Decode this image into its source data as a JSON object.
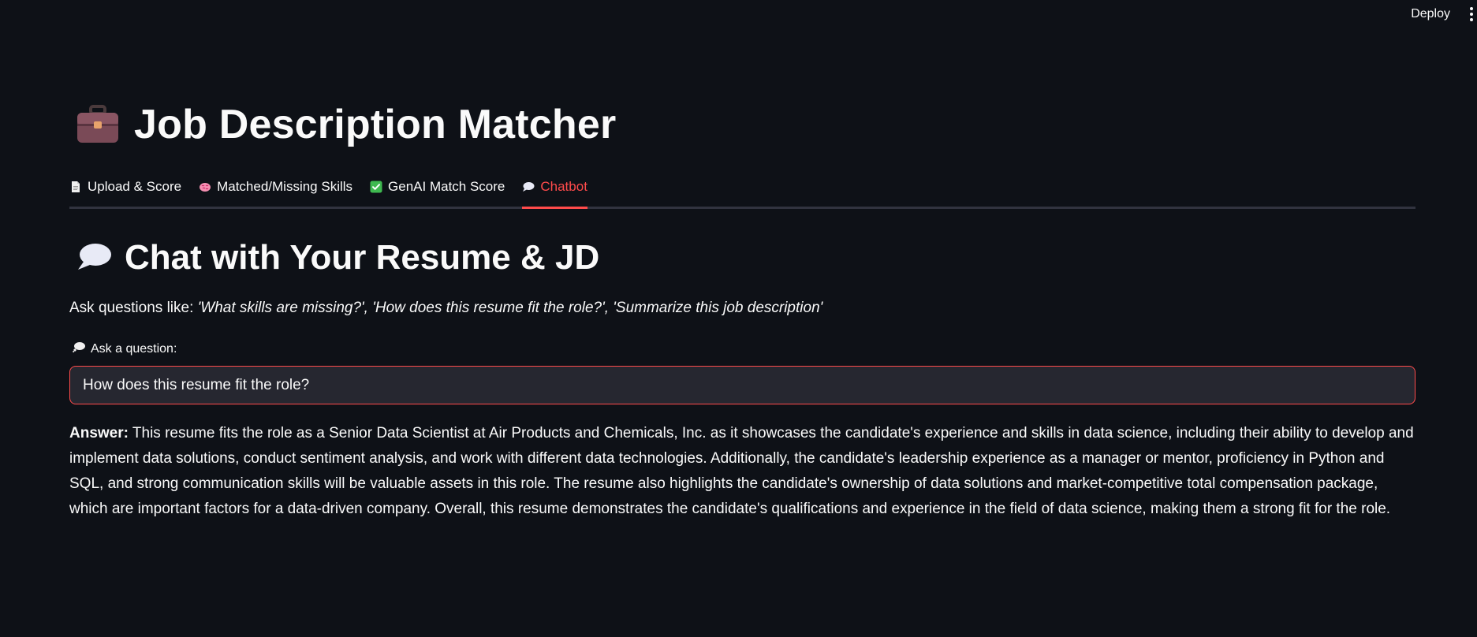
{
  "topbar": {
    "deploy_label": "Deploy",
    "menu_icon": "kebab-menu-icon"
  },
  "header": {
    "icon": "briefcase-icon",
    "title": "Job Description Matcher"
  },
  "tabs": [
    {
      "label": "Upload & Score",
      "icon": "page-icon",
      "active": false
    },
    {
      "label": "Matched/Missing Skills",
      "icon": "brain-icon",
      "active": false
    },
    {
      "label": "GenAI Match Score",
      "icon": "check-mark-icon",
      "active": false
    },
    {
      "label": "Chatbot",
      "icon": "speech-balloon-icon",
      "active": true
    }
  ],
  "section": {
    "icon": "speech-balloon-icon",
    "title": "Chat with Your Resume & JD"
  },
  "hint": {
    "prefix": "Ask questions like: ",
    "examples": "'What skills are missing?', 'How does this resume fit the role?', 'Summarize this job description'"
  },
  "question": {
    "label_icon": "thought-balloon-icon",
    "label": "Ask a question:",
    "value": "How does this resume fit the role?"
  },
  "answer": {
    "label": "Answer:",
    "text": " This resume fits the role as a Senior Data Scientist at Air Products and Chemicals, Inc. as it showcases the candidate's experience and skills in data science, including their ability to develop and implement data solutions, conduct sentiment analysis, and work with different data technologies. Additionally, the candidate's leadership experience as a manager or mentor, proficiency in Python and SQL, and strong communication skills will be valuable assets in this role. The resume also highlights the candidate's ownership of data solutions and market-competitive total compensation package, which are important factors for a data-driven company. Overall, this resume demonstrates the candidate's qualifications and experience in the field of data science, making them a strong fit for the role."
  },
  "colors": {
    "background": "#0e1117",
    "accent": "#ff4b4b",
    "input_bg": "#262730",
    "text": "#fafafa"
  }
}
